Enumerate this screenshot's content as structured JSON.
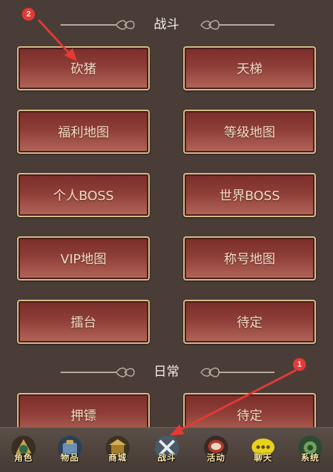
{
  "sections": {
    "battle_title": "战斗",
    "daily_title": "日常"
  },
  "battle_buttons": [
    "砍猪",
    "天梯",
    "福利地图",
    "等级地图",
    "个人BOSS",
    "世界BOSS",
    "VIP地图",
    "称号地图",
    "擂台",
    "待定"
  ],
  "daily_buttons": [
    "押镖",
    "待定"
  ],
  "bottom_nav": [
    {
      "label": "角色",
      "icon": "role-icon"
    },
    {
      "label": "物品",
      "icon": "items-icon"
    },
    {
      "label": "商城",
      "icon": "shop-icon"
    },
    {
      "label": "战斗",
      "icon": "battle-icon"
    },
    {
      "label": "活动",
      "icon": "activity-icon"
    },
    {
      "label": "聊天",
      "icon": "chat-icon"
    },
    {
      "label": "系统",
      "icon": "system-icon"
    }
  ],
  "annotations": {
    "badge_1": "1",
    "badge_2": "2",
    "color": "#e53935"
  }
}
